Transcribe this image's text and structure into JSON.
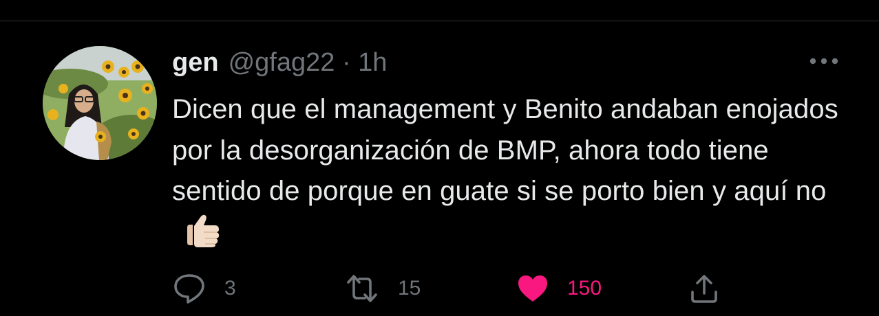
{
  "tweet": {
    "author": {
      "display_name": "gen",
      "handle": "@gfag22",
      "separator": "·",
      "time": "1h"
    },
    "text": "Dicen que el management y Benito andaban enojados por la desorganización de BMP, ahora todo tiene sentido de porque en guate si se porto bien y aquí no",
    "emoji": "thumbs-up-light-skin-tone",
    "actions": {
      "reply_count": "3",
      "retweet_count": "15",
      "like_count": "150",
      "liked": true
    },
    "icons": {
      "more": "more-horizontal-icon",
      "reply": "reply-icon",
      "retweet": "retweet-icon",
      "like": "heart-filled-icon",
      "share": "share-icon"
    }
  },
  "colors": {
    "background": "#000000",
    "text_primary": "#e7e9ea",
    "text_secondary": "#71767b",
    "like": "#f91880",
    "divider": "#2f3336"
  }
}
